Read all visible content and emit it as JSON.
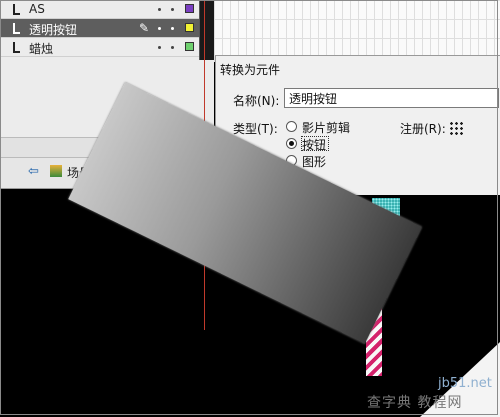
{
  "layers": [
    {
      "name": "AS",
      "color": "#7a3fc2"
    },
    {
      "name": "透明按钮",
      "color": "#f2f233",
      "selected": true
    },
    {
      "name": "蜡烛",
      "color": "#6fd16f"
    }
  ],
  "scene": {
    "label": "场景 1"
  },
  "dialog": {
    "title": "转换为元件",
    "name_label": "名称(N):",
    "name_value": "透明按钮",
    "type_label": "类型(T):",
    "registration_label": "注册(R):",
    "types": [
      {
        "label": "影片剪辑",
        "selected": false
      },
      {
        "label": "按钮",
        "selected": true
      },
      {
        "label": "图形",
        "selected": false
      }
    ]
  },
  "watermark": {
    "site": "jb51.net",
    "cn": "查字典 教程网"
  },
  "icons": {
    "back": "back-arrow-icon",
    "scene": "scene-icon",
    "pencil": "pencil-icon",
    "registration": "registration-grid-icon"
  }
}
